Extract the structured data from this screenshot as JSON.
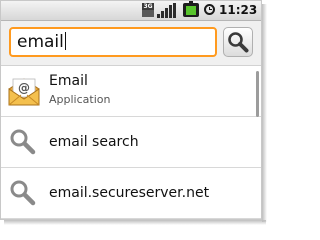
{
  "status_bar": {
    "network_label": "3G",
    "time": "11:23 PM",
    "battery_color": "#58c52c"
  },
  "search": {
    "query": "email",
    "focus_color": "#ff9a1f",
    "button_icon": "search-icon"
  },
  "suggestions": [
    {
      "title": "Email",
      "subtitle": "Application",
      "icon": "email-app-icon"
    },
    {
      "title": "email search",
      "icon": "search-icon"
    },
    {
      "title": "email.secureserver.net",
      "icon": "search-icon"
    }
  ]
}
